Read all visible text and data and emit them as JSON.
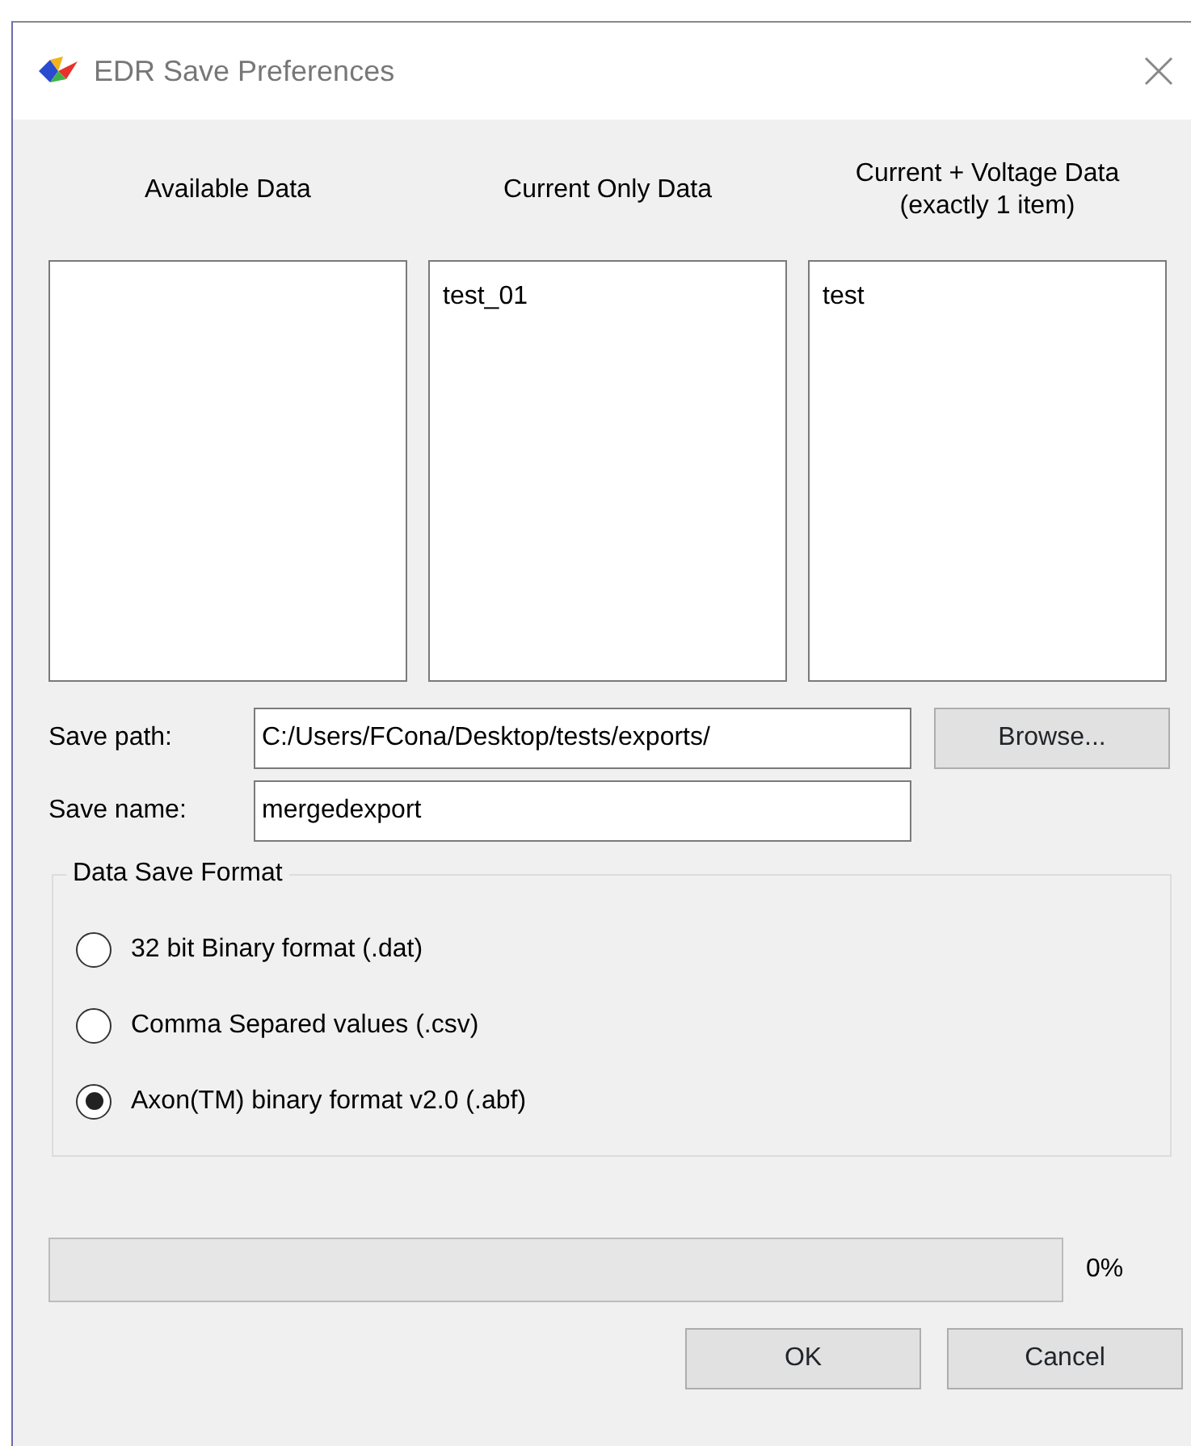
{
  "window": {
    "title": "EDR Save Preferences"
  },
  "lists": [
    {
      "header": "Available Data"
    },
    {
      "header": "Current Only Data",
      "items": [
        "test_01"
      ]
    },
    {
      "header": "Current + Voltage Data\n(exactly 1 item)",
      "items": [
        "test"
      ]
    }
  ],
  "save_path": {
    "label": "Save path:",
    "value": "C:/Users/FCona/Desktop/tests/exports/"
  },
  "browse_button": "Browse...",
  "save_name": {
    "label": "Save name:",
    "value": "mergedexport"
  },
  "format_group": {
    "title": "Data Save Format",
    "options": [
      {
        "label": "32 bit Binary format (.dat)",
        "selected": false
      },
      {
        "label": "Comma Separed values (.csv)",
        "selected": false
      },
      {
        "label": "Axon(TM) binary format v2.0 (.abf)",
        "selected": true
      }
    ]
  },
  "progress": {
    "level": 0,
    "reading": "0%"
  },
  "buttons": [
    "OK",
    "Cancel"
  ]
}
